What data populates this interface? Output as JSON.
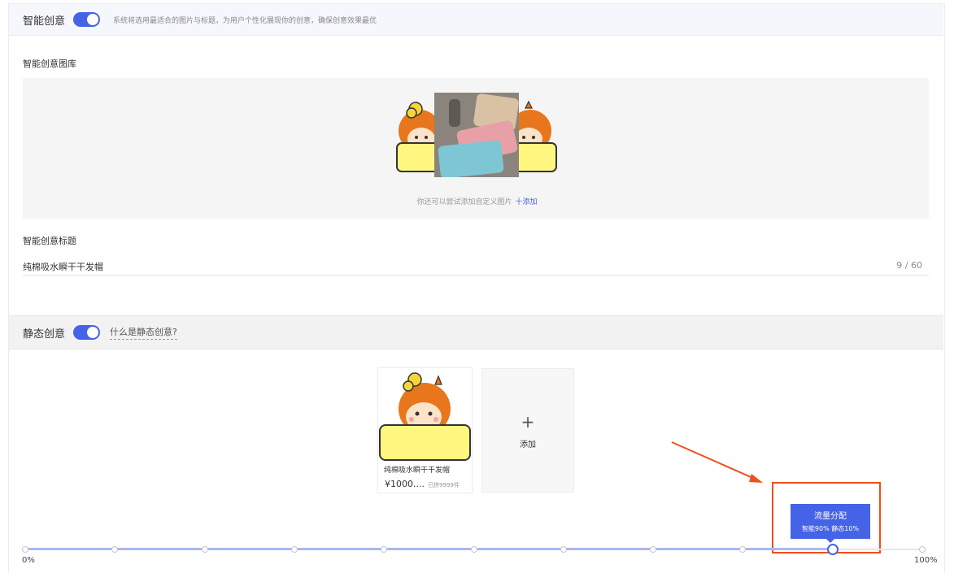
{
  "smart": {
    "title": "智能创意",
    "hint": "系统将选用最适合的图片与标题，为用户个性化展现你的创意，确保创意效果最优",
    "gallery_label": "智能创意图库",
    "gallery_hint": "你还可以尝试添加自定义图片",
    "gallery_add": "十添加",
    "title_label": "智能创意标题",
    "title_value": "纯棉吸水瞬干干发帽",
    "title_count": "9 / 60"
  },
  "static": {
    "title": "静态创意",
    "help": "什么是静态创意?",
    "card": {
      "name": "纯棉吸水瞬干干发帽",
      "price": "¥1000....",
      "sold": "已拼9999件"
    },
    "add_plus": "+",
    "add_label": "添加"
  },
  "traffic": {
    "tooltip_title": "流量分配",
    "tooltip_detail": "智能90% 静态10%",
    "min_label": "0%",
    "max_label": "100%",
    "value_percent": 90,
    "steps": 10
  },
  "colors": {
    "accent": "#4563e6",
    "highlight": "#f04e1a"
  }
}
